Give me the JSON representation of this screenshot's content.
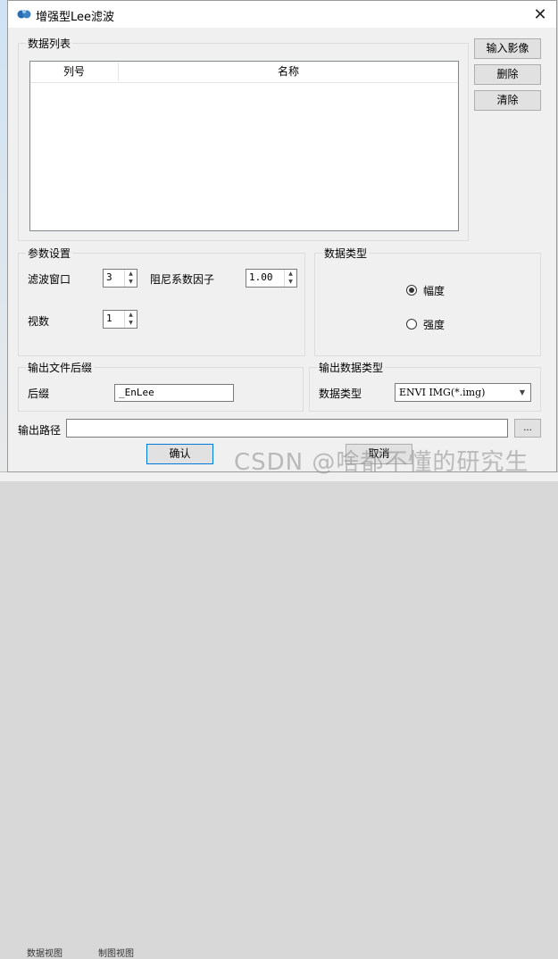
{
  "window": {
    "title": "增强型Lee滤波"
  },
  "data_list": {
    "group_label": "数据列表",
    "columns": [
      "列号",
      "名称"
    ],
    "buttons": {
      "input": "输入影像",
      "delete": "删除",
      "clear": "清除"
    }
  },
  "params": {
    "group_label": "参数设置",
    "filter_window_label": "滤波窗口",
    "filter_window_value": "3",
    "damping_label": "阻尼系数因子",
    "damping_value": "1.00",
    "looks_label": "视数",
    "looks_value": "1"
  },
  "data_type": {
    "group_label": "数据类型",
    "options": [
      "幅度",
      "强度"
    ],
    "selected": "幅度"
  },
  "output_suffix": {
    "group_label": "输出文件后缀",
    "label": "后缀",
    "value": "_EnLee"
  },
  "output_data_type": {
    "group_label": "输出数据类型",
    "label": "数据类型",
    "value": "ENVI IMG(*.img)"
  },
  "output_path": {
    "label": "输出路径",
    "value": "",
    "browse": "..."
  },
  "footer": {
    "ok": "确认",
    "cancel": "取消"
  },
  "watermark": "CSDN @啥都不懂的研究生",
  "background": {
    "tab1": "数据视图",
    "tab2": "制图视图"
  }
}
